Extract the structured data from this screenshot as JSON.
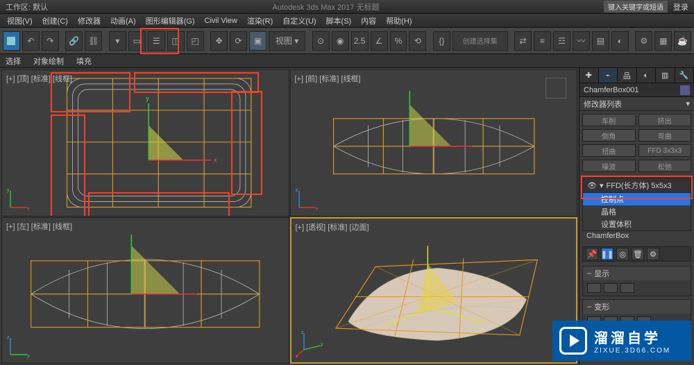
{
  "title_left": "工作区: 默认",
  "title_app": "Autodesk 3ds Max 2017  无标题",
  "search_placeholder": "键入关键字或短语",
  "login_label": "登录",
  "menu": {
    "view_dropdown": "视图(V)",
    "create": "创建(C)",
    "modifier": "修改器",
    "animation": "动画(A)",
    "graph": "图形编辑器(G)",
    "civil": "Civil View",
    "render": "渲染(R)",
    "customize": "自定义(U)",
    "script": "脚本(S)",
    "content": "内容",
    "help": "帮助(H)"
  },
  "second_bar": {
    "select": "选择",
    "obj_paint": "对象绘制",
    "fill": "填充"
  },
  "toolbar_text_225": "2.5",
  "selectset_placeholder": "创建选择集",
  "viewports": {
    "top": "[+] [顶] [标准] [线框]",
    "front": "[+] [前] [标准] [线框]",
    "left": "[+] [左] [标准] [线框]",
    "persp": "[+] [透视] [标准] [边面]"
  },
  "cmdpanel": {
    "object_name": "ChamferBox001",
    "modlist_label": "修改器列表",
    "buttons": {
      "car_cut": "车削",
      "extrude": "挤出",
      "bevel": "倒角",
      "bend": "弯曲",
      "twist": "扭曲",
      "ffd3": "FFD 3x3x3",
      "noise": "噪波",
      "relax": "松弛"
    },
    "stack_head": "FFD(长方体) 5x5x3",
    "stack_items": {
      "control_points": "控制点",
      "lattice": "晶格",
      "set_volume": "设置体积"
    },
    "stack_root": "ChamferBox",
    "rollup1_title": "显示",
    "rollup2_title": "变形"
  },
  "watermark": {
    "line1": "溜溜自学",
    "line2": "ZIXUE.3D66.COM"
  }
}
